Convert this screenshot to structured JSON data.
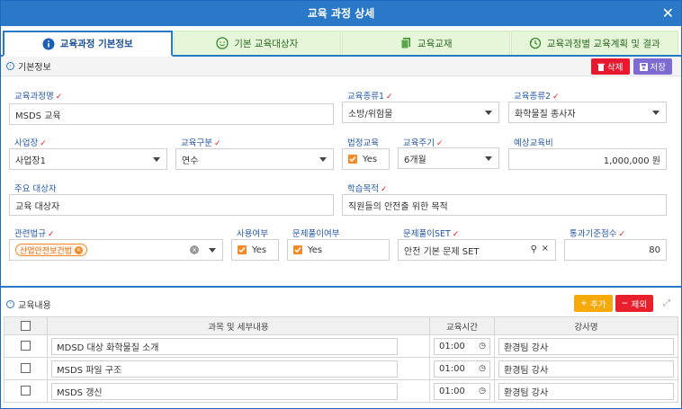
{
  "window": {
    "title": "교육 과정 상세",
    "close_label": "✕"
  },
  "tabs": [
    {
      "label": "교육과정 기본정보",
      "icon": "info-icon"
    },
    {
      "label": "기본 교육대상자",
      "icon": "user-icon"
    },
    {
      "label": "교육교재",
      "icon": "document-icon"
    },
    {
      "label": "교육과정별 교육계획 및 결과",
      "icon": "history-icon"
    }
  ],
  "basic": {
    "section_title": "기본정보",
    "delete_label": "삭제",
    "save_label": "저장",
    "course_name_label": "교육과정명",
    "course_name_value": "MSDS 교육",
    "type1_label": "교육종류1",
    "type1_value": "소방/위험물",
    "type2_label": "교육종류2",
    "type2_value": "화학물질 종사자",
    "site_label": "사업장",
    "site_value": "사업장1",
    "category_label": "교육구분",
    "category_value": "연수",
    "legal_label": "법정교육",
    "legal_value": "Yes",
    "cycle_label": "교육주기",
    "cycle_value": "6개월",
    "cost_label": "예상교육비",
    "cost_value": "1,000,000 원",
    "target_label": "주요 대상자",
    "target_value": "교육 대상자",
    "purpose_label": "학습목적",
    "purpose_value": "직원들의 안전출 위한 목적",
    "law_label": "관련법규",
    "law_tag": "산업안전보건법",
    "use_label": "사용여부",
    "use_value": "Yes",
    "quiz_label": "문제풀이여부",
    "quiz_value": "Yes",
    "quizset_label": "문제풀이SET",
    "quizset_value": "안전 기본 문제 SET",
    "pass_label": "통과기준점수",
    "pass_value": "80"
  },
  "content": {
    "section_title": "교육내용",
    "add_label": "추가",
    "remove_label": "제외",
    "columns": [
      "과목 및 세부내용",
      "교육시간",
      "강사명"
    ],
    "rows": [
      {
        "subject": "MDSD 대상 화학물질 소개",
        "time": "01:00",
        "instructor": "환경팀 강사"
      },
      {
        "subject": "MSDS 파일 구조",
        "time": "01:00",
        "instructor": "환경팀 강사"
      },
      {
        "subject": "MSDS 갱신",
        "time": "01:00",
        "instructor": "환경팀 강사"
      }
    ]
  }
}
